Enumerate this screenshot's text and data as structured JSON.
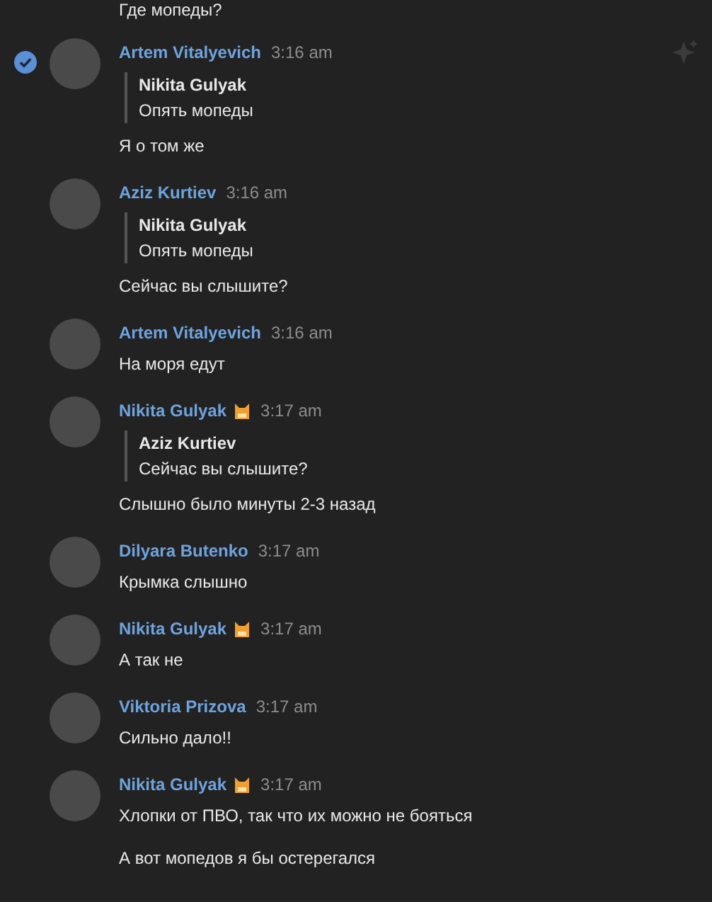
{
  "top_message": {
    "text": "Где мопеды?"
  },
  "messages": [
    {
      "author": "Artem Vitalyevich",
      "badge": false,
      "time": "3:16 am",
      "selected": true,
      "quote": {
        "author": "Nikita Gulyak",
        "text": "Опять мопеды"
      },
      "texts": [
        "Я о том же"
      ]
    },
    {
      "author": "Aziz Kurtiev",
      "badge": false,
      "time": "3:16 am",
      "selected": false,
      "quote": {
        "author": "Nikita Gulyak",
        "text": "Опять мопеды"
      },
      "texts": [
        "Сейчас вы слышите?"
      ]
    },
    {
      "author": "Artem Vitalyevich",
      "badge": false,
      "time": "3:16 am",
      "selected": false,
      "texts": [
        "На моря едут"
      ]
    },
    {
      "author": "Nikita Gulyak",
      "badge": true,
      "time": "3:17 am",
      "selected": false,
      "quote": {
        "author": "Aziz Kurtiev",
        "text": "Сейчас вы слышите?"
      },
      "texts": [
        "Слышно было минуты 2-3 назад"
      ]
    },
    {
      "author": "Dilyara Butenko",
      "badge": false,
      "time": "3:17 am",
      "selected": false,
      "texts": [
        "Крымка слышно"
      ]
    },
    {
      "author": "Nikita Gulyak",
      "badge": true,
      "time": "3:17 am",
      "selected": false,
      "texts": [
        "А так не"
      ]
    },
    {
      "author": "Viktoria Prizova",
      "badge": false,
      "time": "3:17 am",
      "selected": false,
      "texts": [
        "Сильно дало!!"
      ]
    },
    {
      "author": "Nikita Gulyak",
      "badge": true,
      "time": "3:17 am",
      "selected": false,
      "texts": [
        "Хлопки от ПВО, так что их можно не бояться",
        "А вот мопедов я бы остерегался"
      ]
    }
  ]
}
